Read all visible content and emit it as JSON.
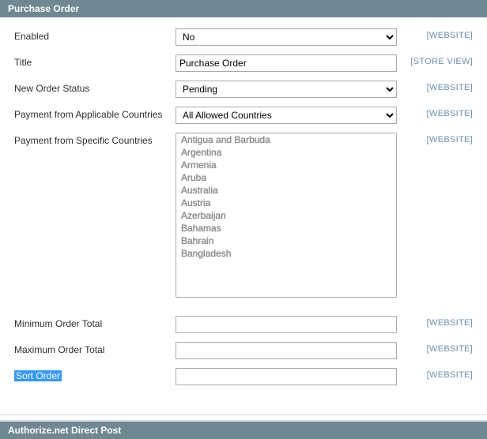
{
  "section": {
    "title": "Purchase Order"
  },
  "fields": {
    "enabled": {
      "label": "Enabled",
      "value": "No",
      "scope": "[WEBSITE]"
    },
    "title": {
      "label": "Title",
      "value": "Purchase Order",
      "scope": "[STORE VIEW]"
    },
    "new_order_status": {
      "label": "New Order Status",
      "value": "Pending",
      "scope": "[WEBSITE]"
    },
    "payment_applicable": {
      "label": "Payment from Applicable Countries",
      "value": "All Allowed Countries",
      "scope": "[WEBSITE]"
    },
    "payment_specific": {
      "label": "Payment from Specific Countries",
      "scope": "[WEBSITE]",
      "options": [
        "Antigua and Barbuda",
        "Argentina",
        "Armenia",
        "Aruba",
        "Australia",
        "Austria",
        "Azerbaijan",
        "Bahamas",
        "Bahrain",
        "Bangladesh"
      ]
    },
    "min_order_total": {
      "label": "Minimum Order Total",
      "value": "",
      "scope": "[WEBSITE]"
    },
    "max_order_total": {
      "label": "Maximum Order Total",
      "value": "",
      "scope": "[WEBSITE]"
    },
    "sort_order": {
      "label": "Sort Order",
      "value": "",
      "scope": "[WEBSITE]"
    }
  },
  "footer": {
    "title": "Authorize.net Direct Post"
  }
}
